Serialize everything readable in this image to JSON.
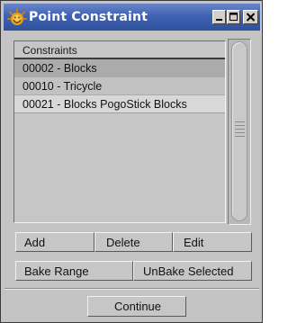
{
  "window": {
    "title": "Point Constraint",
    "icon": "lightwave-app-icon",
    "controls": {
      "minimize": "minimize-icon",
      "maximize": "maximize-icon",
      "close": "close-icon"
    }
  },
  "list": {
    "header": "Constraints",
    "items": [
      {
        "label": "00002 - Blocks"
      },
      {
        "label": "00010 - Tricycle"
      },
      {
        "label": "00021 -  Blocks PogoStick Blocks"
      }
    ]
  },
  "buttons": {
    "add": "Add",
    "delete": "Delete",
    "edit": "Edit",
    "bake_range": "Bake Range",
    "unbake_selected": "UnBake Selected",
    "continue": "Continue"
  },
  "colors": {
    "titlebar": "#3f62b3",
    "panel": "#c4c4c4"
  }
}
